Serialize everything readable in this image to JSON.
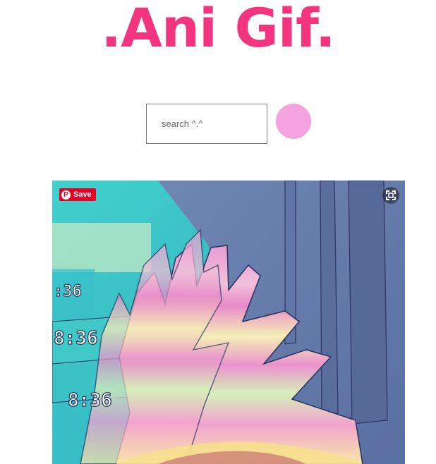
{
  "header": {
    "logo_text": ".Ani Gif."
  },
  "search": {
    "placeholder": "search ^.^",
    "value": "",
    "button_color": "#f5a3de"
  },
  "gif": {
    "save_label": "Save",
    "overlay_clock_text": [
      "8:36",
      "8:36",
      ":36"
    ],
    "fullscreen_icon": "fullscreen-icon",
    "pin_icon": "pinterest-icon"
  },
  "colors": {
    "brand": "#f2357e",
    "pinterest": "#e60023"
  }
}
